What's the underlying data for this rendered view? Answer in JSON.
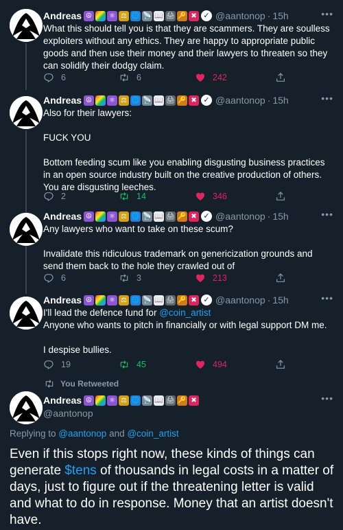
{
  "author": {
    "name": "Andreas",
    "handle": "@aantonop",
    "emojis": [
      {
        "glyph": "☮",
        "color": "#8b55d4"
      },
      {
        "glyph": "",
        "color": "rainbow"
      },
      {
        "glyph": "⚛",
        "color": "#8b55d4"
      },
      {
        "glyph": "⚖",
        "color": "#d4a017"
      },
      {
        "glyph": "🌐",
        "color": "#2a7bd4"
      },
      {
        "glyph": "📡",
        "color": "#7d8a96"
      },
      {
        "glyph": "📖",
        "color": "#e8eef2"
      },
      {
        "glyph": "🖨",
        "color": "#5c6670"
      },
      {
        "glyph": "🔑",
        "color": "#d47a1a"
      },
      {
        "glyph": "✖",
        "color": "#e0245e"
      }
    ]
  },
  "thread": [
    {
      "time": "15h",
      "paragraphs": [
        "What this should tell you is that they are scammers. They are soulless exploiters without any ethics. They are happy to appropriate public goods and then use their money and their lawyers to threaten so they can solidify their dodgy claim."
      ],
      "replies": "6",
      "retweets": "6",
      "likes": "242",
      "retweeted": false
    },
    {
      "time": "15h",
      "paragraphs": [
        "Also for their lawyers:",
        "FUCK YOU",
        "Bottom feeding scum like you enabling disgusting business practices in an open source industry built on the creative production of others. You are disgusting leeches."
      ],
      "replies": "2",
      "retweets": "14",
      "likes": "346",
      "retweeted": true
    },
    {
      "time": "15h",
      "paragraphs": [
        "Any lawyers who want to take on these scum?",
        "Invalidate this ridiculous trademark on genericization grounds and send them back to the hole they crawled out of"
      ],
      "replies": "6",
      "retweets": "3",
      "likes": "213",
      "retweeted": false
    },
    {
      "time": "15h",
      "line1_prefix": "I'll lead the defence fund for ",
      "line1_mention": "@coin_artist",
      "line2": "Anyone who wants to pitch in financially or with legal support DM me.",
      "line3": "I despise bullies.",
      "replies": "19",
      "retweets": "45",
      "likes": "494",
      "retweeted": true
    }
  ],
  "retweet_banner": "You Retweeted",
  "main_tweet": {
    "replying_prefix": "Replying to ",
    "replying_user1": "@aantonop",
    "replying_and": " and ",
    "replying_user2": "@coin_artist",
    "text_before": "Even if this stops right now, these kinds of things can generate ",
    "cashtag": "$tens",
    "text_after": " of thousands in legal costs in a matter of days, just to figure out if the threatening letter is valid and what to do in response. Money that an artist doesn't have."
  },
  "colors": {
    "background": "#15202b",
    "secondary_text": "#8899a6",
    "link": "#1da1f2",
    "retweet_green": "#17bf63",
    "like_red": "#e0245e"
  },
  "icons": [
    "reply-icon",
    "retweet-icon",
    "heart-icon",
    "share-icon",
    "more-icon",
    "verified-icon"
  ]
}
